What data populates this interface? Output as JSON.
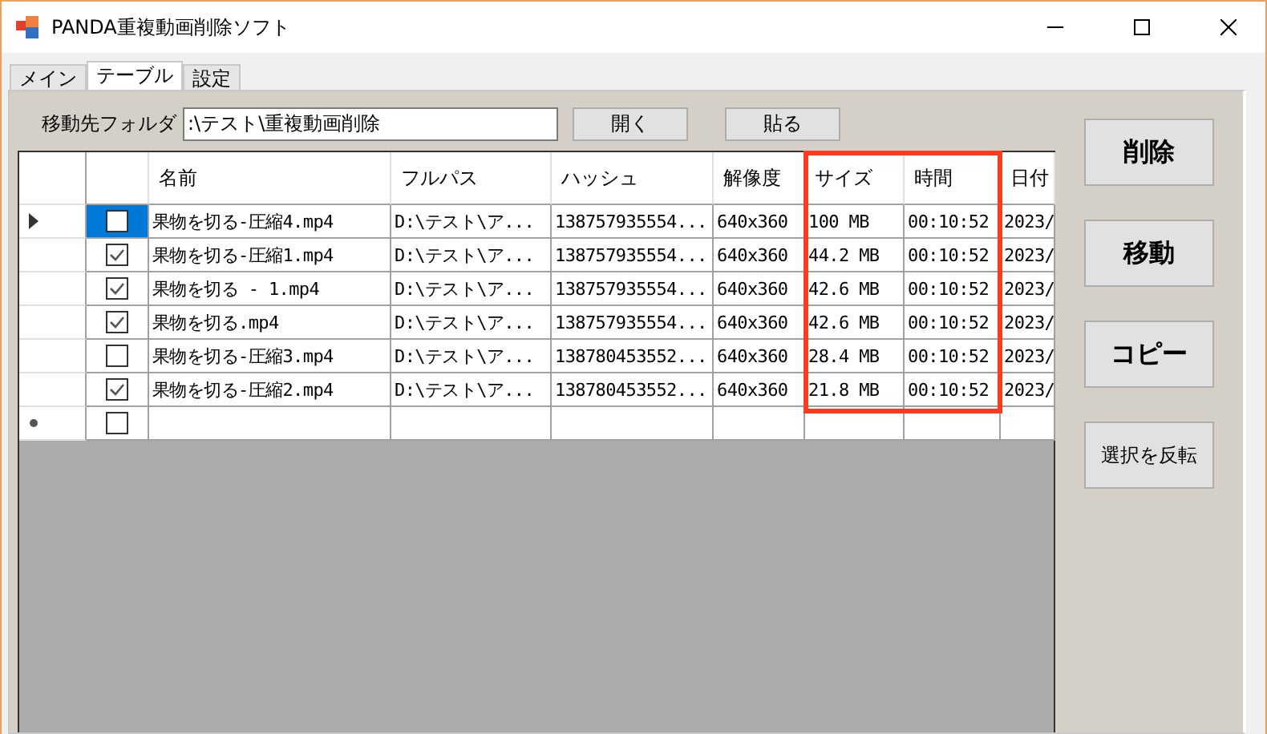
{
  "window": {
    "title": "PANDA重複動画削除ソフト"
  },
  "tabs": [
    {
      "label": "メイン",
      "selected": false
    },
    {
      "label": "テーブル",
      "selected": true
    },
    {
      "label": "設定",
      "selected": false
    }
  ],
  "folder": {
    "label": "移動先フォルダ",
    "value": ":\\テスト\\重複動画削除",
    "buttons": [
      "開く",
      "貼る"
    ]
  },
  "table": {
    "columns": [
      "",
      "名前",
      "フルパス",
      "ハッシュ",
      "解像度",
      "サイズ",
      "時間",
      "日付"
    ],
    "rows": [
      {
        "current": true,
        "checked": false,
        "name": "果物を切る-圧縮4.mp4",
        "path": "D:\\テスト\\ア...",
        "hash": "138757935554...",
        "resolution": "640x360",
        "size": "100 MB",
        "time": "00:10:52",
        "date": "2023/"
      },
      {
        "current": false,
        "checked": true,
        "name": "果物を切る-圧縮1.mp4",
        "path": "D:\\テスト\\ア...",
        "hash": "138757935554...",
        "resolution": "640x360",
        "size": "44.2 MB",
        "time": "00:10:52",
        "date": "2023/"
      },
      {
        "current": false,
        "checked": true,
        "name": "果物を切る - 1.mp4",
        "path": "D:\\テスト\\ア...",
        "hash": "138757935554...",
        "resolution": "640x360",
        "size": "42.6 MB",
        "time": "00:10:52",
        "date": "2023/"
      },
      {
        "current": false,
        "checked": true,
        "name": "果物を切る.mp4",
        "path": "D:\\テスト\\ア...",
        "hash": "138757935554...",
        "resolution": "640x360",
        "size": "42.6 MB",
        "time": "00:10:52",
        "date": "2023/"
      },
      {
        "current": false,
        "checked": false,
        "name": "果物を切る-圧縮3.mp4",
        "path": "D:\\テスト\\ア...",
        "hash": "138780453552...",
        "resolution": "640x360",
        "size": "28.4 MB",
        "time": "00:10:52",
        "date": "2023/"
      },
      {
        "current": false,
        "checked": true,
        "name": "果物を切る-圧縮2.mp4",
        "path": "D:\\テスト\\ア...",
        "hash": "138780453552...",
        "resolution": "640x360",
        "size": "21.8 MB",
        "time": "00:10:52",
        "date": "2023/"
      }
    ],
    "new_row": {
      "checked": false
    }
  },
  "actions": [
    "削除",
    "移動",
    "コピー",
    "選択を反転"
  ]
}
